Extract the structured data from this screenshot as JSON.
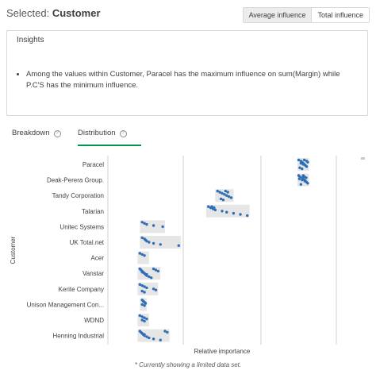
{
  "header": {
    "title_prefix": "Selected:",
    "title_field": "Customer",
    "toggle": {
      "average_label": "Average influence",
      "total_label": "Total influence",
      "active": "average"
    }
  },
  "insights": {
    "title": "Insights",
    "items": [
      "Among the values within Customer, Paracel has the maximum influence on sum(Margin) while P.C'S has the minimum influence."
    ]
  },
  "tabs": [
    {
      "label": "Breakdown",
      "active": false
    },
    {
      "label": "Distribution",
      "active": true
    }
  ],
  "chart_data": {
    "type": "scatter",
    "xlabel": "Relative importance",
    "ylabel": "Customer",
    "categories": [
      "Paracel",
      "Deak-Perera Group.",
      "Tandy Corporation",
      "Talarian",
      "Unitec Systems",
      "UK Total.net",
      "Acer",
      "Vanstar",
      "Kerite Company",
      "Unison Management Con...",
      "WDND",
      "Henning Industrial"
    ],
    "ranges": [
      [
        0.83,
        0.88
      ],
      [
        0.83,
        0.88
      ],
      [
        0.47,
        0.55
      ],
      [
        0.43,
        0.62
      ],
      [
        0.14,
        0.25
      ],
      [
        0.14,
        0.32
      ],
      [
        0.13,
        0.18
      ],
      [
        0.13,
        0.23
      ],
      [
        0.13,
        0.22
      ],
      [
        0.14,
        0.17
      ],
      [
        0.13,
        0.18
      ],
      [
        0.13,
        0.27
      ]
    ],
    "points": [
      [
        0.835,
        0.845,
        0.85,
        0.855,
        0.86,
        0.865,
        0.87,
        0.84,
        0.85,
        0.86,
        0.87,
        0.875,
        0.845,
        0.855,
        0.865
      ],
      [
        0.835,
        0.84,
        0.85,
        0.855,
        0.86,
        0.865,
        0.87,
        0.875,
        0.845,
        0.855,
        0.86,
        0.868,
        0.838,
        0.85,
        0.862
      ],
      [
        0.48,
        0.49,
        0.5,
        0.51,
        0.52,
        0.53,
        0.54,
        0.495,
        0.505,
        0.515,
        0.525
      ],
      [
        0.44,
        0.45,
        0.46,
        0.47,
        0.5,
        0.52,
        0.55,
        0.58,
        0.61,
        0.455,
        0.465
      ],
      [
        0.15,
        0.16,
        0.17,
        0.2,
        0.24
      ],
      [
        0.15,
        0.16,
        0.165,
        0.17,
        0.18,
        0.2,
        0.23,
        0.31
      ],
      [
        0.14,
        0.15,
        0.16
      ],
      [
        0.14,
        0.145,
        0.15,
        0.155,
        0.16,
        0.165,
        0.17,
        0.18,
        0.19,
        0.2,
        0.21,
        0.22,
        0.15,
        0.16,
        0.17
      ],
      [
        0.14,
        0.15,
        0.16,
        0.17,
        0.2,
        0.21,
        0.15,
        0.16
      ],
      [
        0.15,
        0.155,
        0.16,
        0.165,
        0.15,
        0.16
      ],
      [
        0.14,
        0.15,
        0.16,
        0.17,
        0.15,
        0.16
      ],
      [
        0.14,
        0.145,
        0.15,
        0.155,
        0.16,
        0.17,
        0.18,
        0.2,
        0.23,
        0.25,
        0.26,
        0.15,
        0.16
      ]
    ],
    "xlim": [
      0,
      1
    ],
    "gridlines": [
      0.0,
      0.33,
      0.67,
      1.0
    ],
    "grid": true,
    "point_color": "#2e6eb5",
    "range_color": "#e6e6e6"
  },
  "footnote": "* Currently showing a limited data set."
}
